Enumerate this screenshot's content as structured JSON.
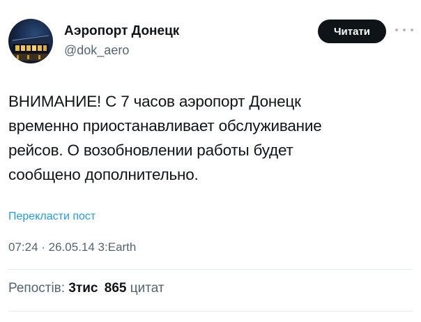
{
  "account": {
    "name": "Аэропорт Донецк",
    "handle": "@dok_aero",
    "follow_label": "Читати"
  },
  "tweet": {
    "lines": [
      "ВНИМАНИЕ! С 7 часов аэропорт Донецк",
      "временно приостанавливает обслуживание",
      "рейсов. О возобновлении работы будет",
      "сообщено дополнительно."
    ],
    "translate_label": "Перекласти пост",
    "meta": "07:24 · 26.05.14 3:Earth"
  },
  "stats": {
    "reposts_label": "Репостів:",
    "reposts_value": "3тис",
    "quotes_value": "865",
    "quotes_label": "цитат"
  },
  "colors": {
    "text": "#0f1419",
    "secondary": "#536471",
    "link": "#1d9bf0",
    "button_bg": "#0f1419"
  },
  "icons": {
    "more": "more-horizontal-icon"
  }
}
